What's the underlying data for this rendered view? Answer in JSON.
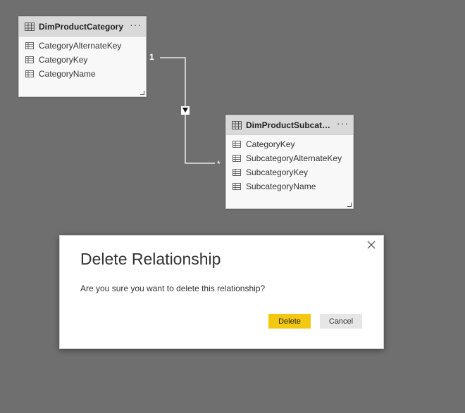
{
  "tables": [
    {
      "name": "DimProductCategory",
      "fields": [
        "CategoryAlternateKey",
        "CategoryKey",
        "CategoryName"
      ]
    },
    {
      "name": "DimProductSubcate...",
      "fields": [
        "CategoryKey",
        "SubcategoryAlternateKey",
        "SubcategoryKey",
        "SubcategoryName"
      ]
    }
  ],
  "more_label": "···",
  "relationship": {
    "one_label": "1",
    "many_label": "*",
    "direction": "single"
  },
  "dialog": {
    "title": "Delete Relationship",
    "message": "Are you sure you want to delete this relationship?",
    "delete_label": "Delete",
    "cancel_label": "Cancel"
  },
  "colors": {
    "canvas": "#6f6f6f",
    "accent": "#f2c811",
    "header": "#d9d9d9"
  }
}
